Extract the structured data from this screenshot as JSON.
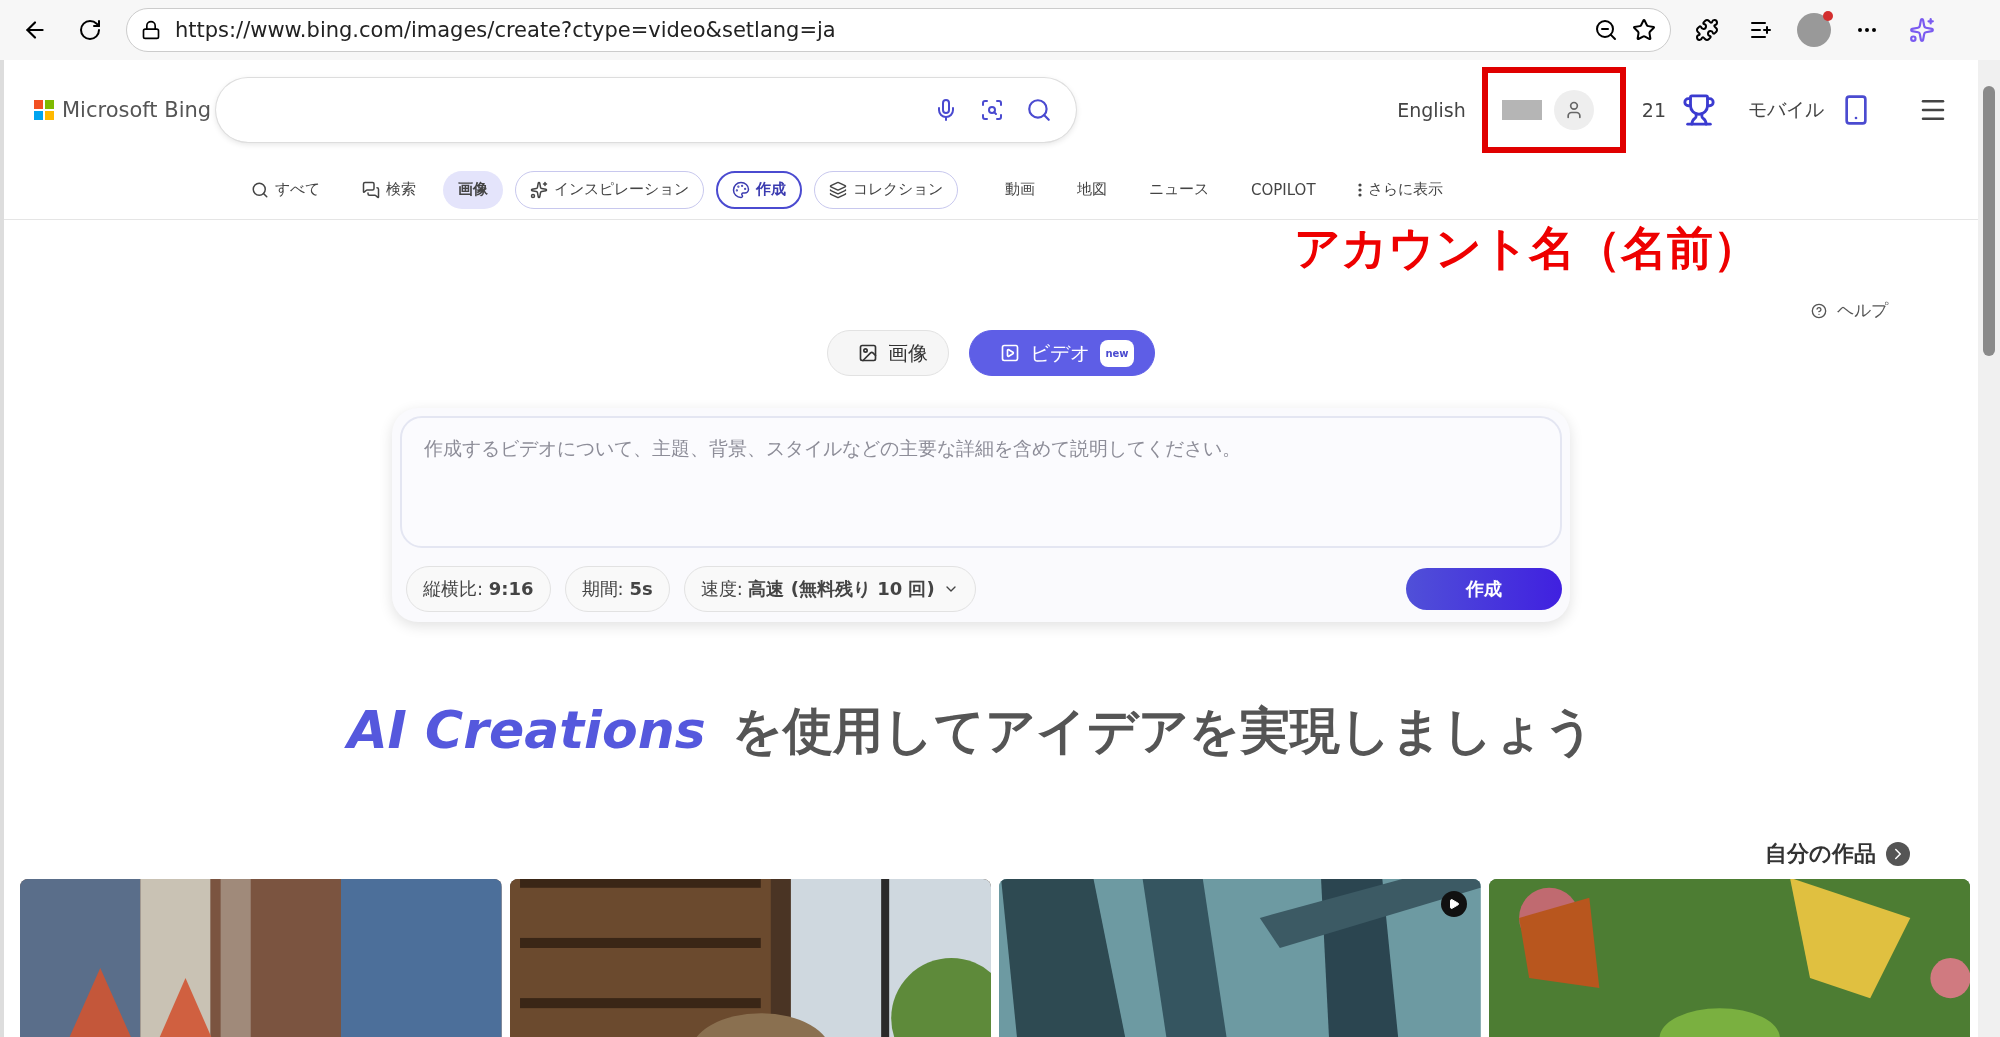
{
  "browser": {
    "url": "https://www.bing.com/images/create?ctype=video&setlang=ja"
  },
  "header": {
    "logo": "Microsoft Bing",
    "language": "English",
    "points": "21",
    "mobile": "モバイル"
  },
  "nav": [
    {
      "label": "すべて",
      "kind": "plain",
      "selected": false
    },
    {
      "label": "検索",
      "kind": "plain",
      "selected": false
    },
    {
      "label": "画像",
      "kind": "plain",
      "selected": true
    },
    {
      "label": "インスピレーション",
      "kind": "chip",
      "selected": false
    },
    {
      "label": "作成",
      "kind": "chip",
      "selected": true
    },
    {
      "label": "コレクション",
      "kind": "chip",
      "selected": false
    },
    {
      "label": "動画",
      "kind": "plain",
      "selected": false
    },
    {
      "label": "地図",
      "kind": "plain",
      "selected": false
    },
    {
      "label": "ニュース",
      "kind": "plain",
      "selected": false
    },
    {
      "label": "COPILOT",
      "kind": "plain",
      "selected": false
    },
    {
      "label": "さらに表示",
      "kind": "more",
      "selected": false
    }
  ],
  "annotation": {
    "label": "アカウント名（名前）"
  },
  "help": "ヘルプ",
  "modes": [
    {
      "label": "画像",
      "selected": false
    },
    {
      "label": "ビデオ",
      "selected": true,
      "badge": "new"
    }
  ],
  "prompt": {
    "placeholder": "作成するビデオについて、主題、背景、スタイルなどの主要な詳細を含めて説明してください。"
  },
  "options": [
    "縦横比: **9:16**",
    "期間: **5s**",
    "速度: **高速 (無料残り 10 回)**"
  ],
  "create_button": "作成",
  "headline": {
    "accent": "AI Creations",
    "rest": "を使用してアイデアを実現しましょう"
  },
  "my_creations": "自分の作品",
  "gallery": [
    {
      "kind": "picture",
      "video": false
    },
    {
      "kind": "picture",
      "video": false
    },
    {
      "kind": "picture",
      "video": true
    },
    {
      "kind": "picture",
      "video": false
    }
  ]
}
